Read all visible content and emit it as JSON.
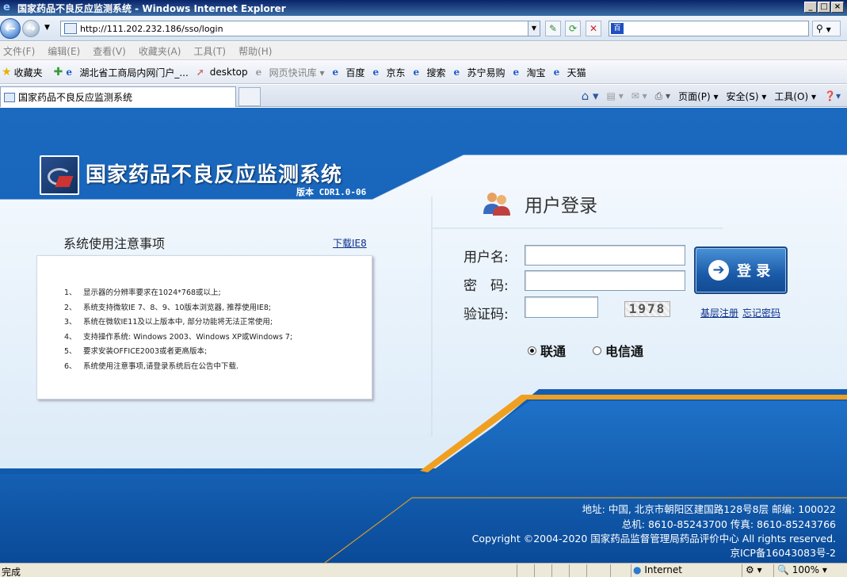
{
  "window": {
    "title": "国家药品不良反应监测系统 - Windows Internet Explorer"
  },
  "address": {
    "url": "http://111.202.232.186/sso/login"
  },
  "menu": [
    "文件(F)",
    "编辑(E)",
    "查看(V)",
    "收藏夹(A)",
    "工具(T)",
    "帮助(H)"
  ],
  "favorites": {
    "label": "收藏夹",
    "items": [
      "湖北省工商局内网门户_...",
      "desktop",
      "网页快讯库 ▾",
      "百度",
      "京东",
      "搜索",
      "苏宁易购",
      "淘宝",
      "天猫"
    ]
  },
  "tab": {
    "title": "国家药品不良反应监测系统"
  },
  "commands": {
    "page": "页面(P) ▾",
    "safety": "安全(S) ▾",
    "tools": "工具(O) ▾"
  },
  "status": {
    "left": "完成",
    "zone": "Internet",
    "zoom": "100%"
  },
  "system": {
    "title": "国家药品不良反应监测系统",
    "version": "版本 CDR1.0-06"
  },
  "notice": {
    "title": "系统使用注意事项",
    "download_link": "下载IE8",
    "items": [
      {
        "n": "1、",
        "t": "显示器的分辨率要求在1024*768或以上;"
      },
      {
        "n": "2、",
        "t": "系统支持微软IE 7、8、9、10版本浏览器, 推荐使用IE8;"
      },
      {
        "n": "3、",
        "t": "系统在微软IE11及以上版本中, 部分功能将无法正常使用;"
      },
      {
        "n": "4、",
        "t": "支持操作系统: Windows 2003、Windows XP或Windows 7;"
      },
      {
        "n": "5、",
        "t": "要求安装OFFICE2003或者更高版本;"
      },
      {
        "n": "6、",
        "t": "系统使用注意事项,请登录系统后在公告中下载."
      }
    ]
  },
  "login": {
    "title": "用户登录",
    "username_label": "用户名:",
    "password_label": "密　码:",
    "captcha_label": "验证码:",
    "captcha_value": "1978",
    "button": "登 录",
    "register_link": "基层注册",
    "forgot_link": "忘记密码",
    "network_options": [
      "联通",
      "电信通"
    ],
    "selected_network": "联通"
  },
  "footer": {
    "line1": "地址: 中国, 北京市朝阳区建国路128号8层  邮编: 100022",
    "line2": "总机: 8610-85243700  传真: 8610-85243766",
    "line3": "Copyright ©2004-2020 国家药品监督管理局药品评价中心  All rights reserved.",
    "line4": "京ICP备16043083号-2"
  },
  "colors": {
    "primary_blue": "#1a66b8",
    "accent_orange": "#f0a020",
    "light_panel": "#e8f2fb"
  }
}
